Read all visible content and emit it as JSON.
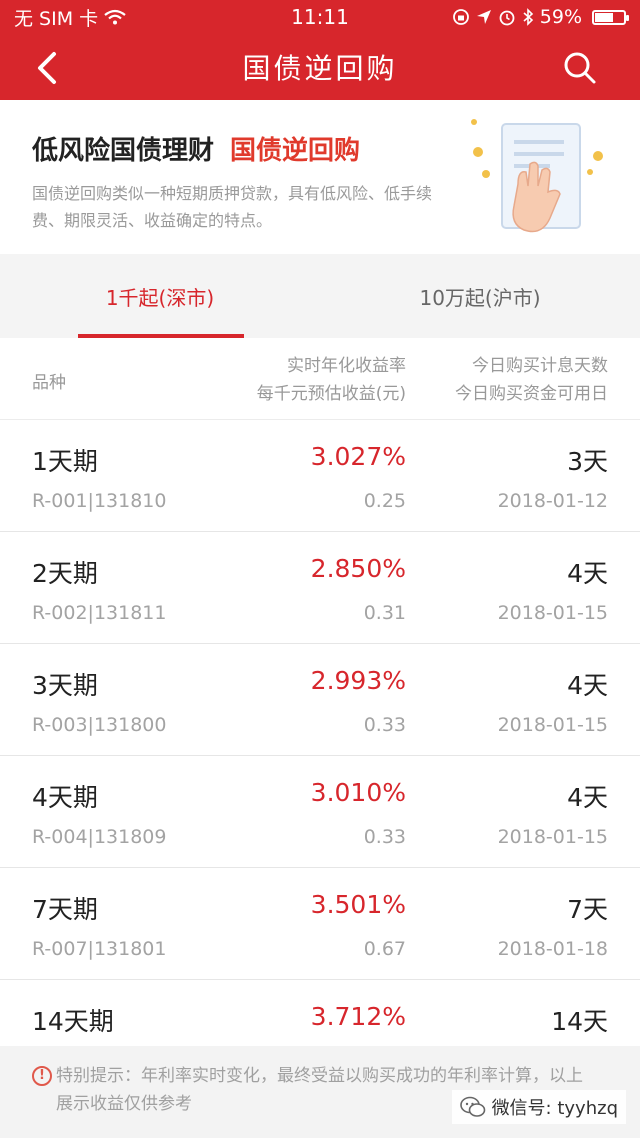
{
  "status": {
    "carrier": "无 SIM 卡",
    "time": "11:11",
    "battery": "59%",
    "battery_level": 0.59
  },
  "nav": {
    "title": "国债逆回购"
  },
  "banner": {
    "headline": "低风险国债理财",
    "highlight": "国债逆回购",
    "description": "国债逆回购类似一种短期质押贷款，具有低风险、低手续费、期限灵活、收益确定的特点。"
  },
  "tabs": [
    {
      "label": "1千起(深市)",
      "active": true
    },
    {
      "label": "10万起(沪市)",
      "active": false
    }
  ],
  "table": {
    "col1": "品种",
    "col2_line1": "实时年化收益率",
    "col2_line2": "每千元预估收益(元)",
    "col3_line1": "今日购买计息天数",
    "col3_line2": "今日购买资金可用日",
    "rows": [
      {
        "name": "1天期",
        "code": "R-001|131810",
        "rate": "3.027%",
        "gain": "0.25",
        "days": "3天",
        "date": "2018-01-12"
      },
      {
        "name": "2天期",
        "code": "R-002|131811",
        "rate": "2.850%",
        "gain": "0.31",
        "days": "4天",
        "date": "2018-01-15"
      },
      {
        "name": "3天期",
        "code": "R-003|131800",
        "rate": "2.993%",
        "gain": "0.33",
        "days": "4天",
        "date": "2018-01-15"
      },
      {
        "name": "4天期",
        "code": "R-004|131809",
        "rate": "3.010%",
        "gain": "0.33",
        "days": "4天",
        "date": "2018-01-15"
      },
      {
        "name": "7天期",
        "code": "R-007|131801",
        "rate": "3.501%",
        "gain": "0.67",
        "days": "7天",
        "date": "2018-01-18"
      },
      {
        "name": "14天期",
        "code": "",
        "rate": "3.712%",
        "gain": "",
        "days": "14天",
        "date": ""
      }
    ]
  },
  "notice": {
    "icon": "!",
    "text": "特别提示：年利率实时变化，最终受益以购买成功的年利率计算，以上展示收益仅供参考"
  },
  "watermark": {
    "text": "微信号: tyyhzq"
  },
  "colors": {
    "brand_red": "#d7262c",
    "accent_orange": "#e03a2c"
  }
}
